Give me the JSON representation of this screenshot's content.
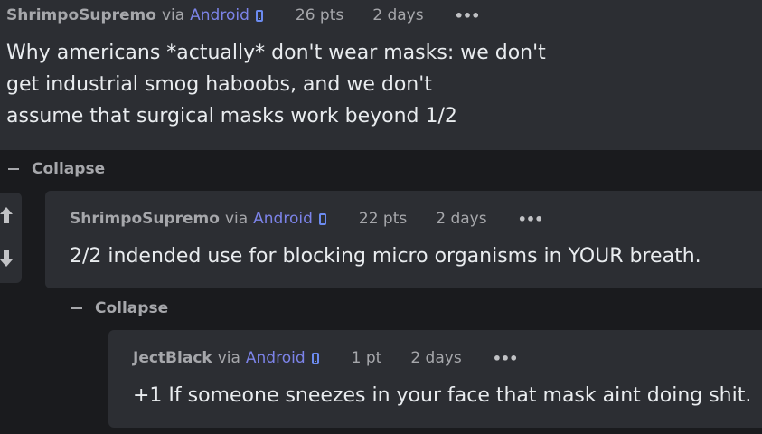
{
  "comments": [
    {
      "author": "ShrimpoSupremo",
      "via": "via",
      "platform": "Android",
      "points": "26 pts",
      "age": "2 days",
      "more_icon": "•••",
      "body_lines": [
        "Why americans *actually* don't wear masks: we don't",
        "get industrial smog haboobs, and we don't",
        "assume that surgical masks work beyond 1/2"
      ],
      "collapse_label": "Collapse"
    },
    {
      "author": "ShrimpoSupremo",
      "via": "via",
      "platform": "Android",
      "points": "22 pts",
      "age": "2 days",
      "more_icon": "•••",
      "body_lines": [
        "2/2 indended use for blocking micro organisms in YOUR breath."
      ],
      "collapse_label": "Collapse"
    },
    {
      "author": "JectBlack",
      "via": "via",
      "platform": "Android",
      "points": "1 pt",
      "age": "2 days",
      "more_icon": "•••",
      "body_lines": [
        "+1 If someone sneezes in your face that mask aint doing shit."
      ]
    }
  ],
  "icons": {
    "phone": "phone-icon",
    "more": "more-options-icon",
    "minus": "minus-icon",
    "upvote": "upvote-arrow-icon",
    "downvote": "downvote-arrow-icon"
  },
  "colors": {
    "background": "#1a1b1e",
    "card": "#2c2e33",
    "text": "#e9ecef",
    "muted": "#a6a7ab",
    "link": "#7c83e8"
  }
}
